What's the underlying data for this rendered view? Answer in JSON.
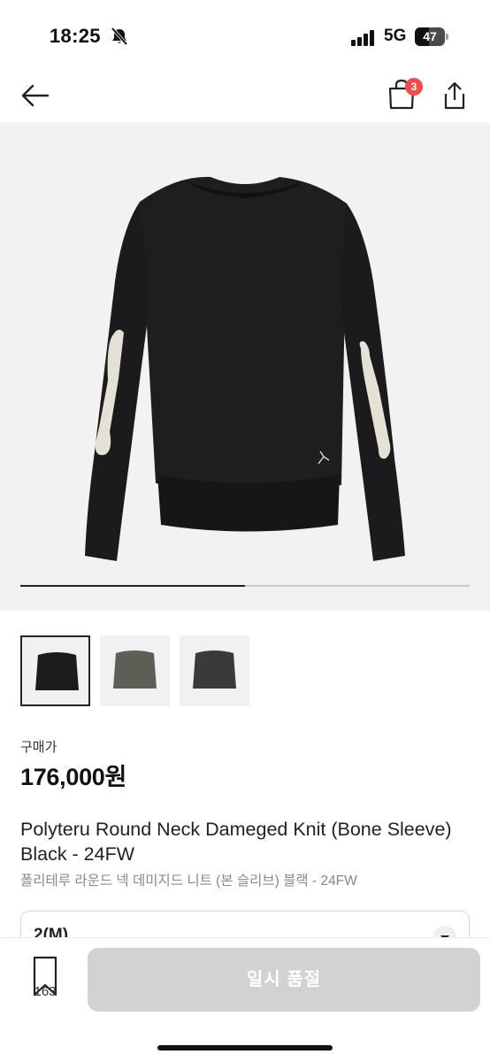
{
  "status_bar": {
    "time": "18:25",
    "network": "5G",
    "battery": "47",
    "battery_level": 0.47
  },
  "nav": {
    "back_icon": "arrow-left-icon",
    "bag_icon": "shopping-bag-icon",
    "bag_count": "3",
    "share_icon": "share-icon"
  },
  "gallery": {
    "progress": 0.5,
    "thumbnails": [
      {
        "color": "#1c1c1e",
        "selected": true
      },
      {
        "color": "#5c5f55",
        "selected": false
      },
      {
        "color": "#3a3a3d",
        "selected": false
      }
    ]
  },
  "product": {
    "price_label": "구매가",
    "price": "176,000원",
    "title": "Polyteru Round Neck Dameged Knit (Bone Sleeve) Black - 24FW",
    "subtitle": "폴리테루 라운드 넥 데미지드 니트 (본 슬리브) 블랙 - 24FW",
    "size": "2(M)"
  },
  "bottom_bar": {
    "wish_icon": "bookmark-icon",
    "wish_count": "163",
    "buy_label": "일시 품절"
  },
  "colors": {
    "badge": "#f24c4c",
    "buy_disabled": "#d2d2d2"
  }
}
